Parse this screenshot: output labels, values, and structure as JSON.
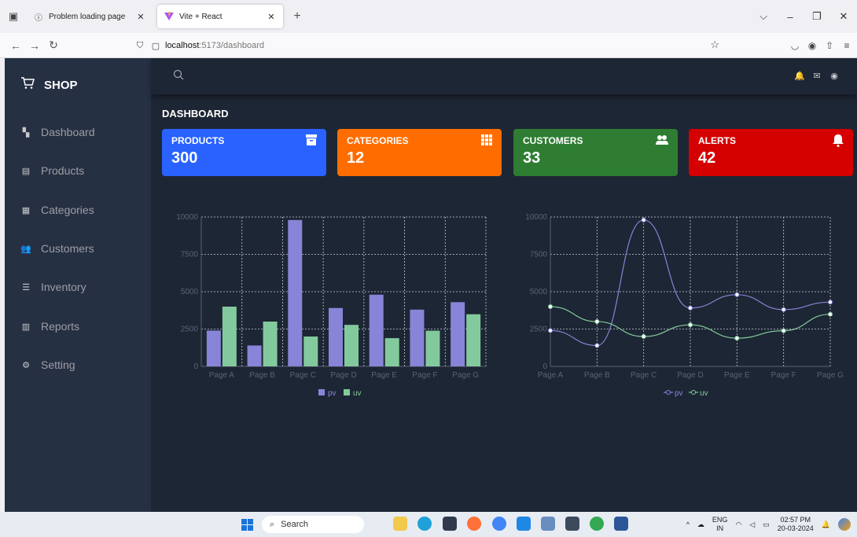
{
  "browser": {
    "tabs": [
      {
        "label": "Problem loading page",
        "icon": "info-icon"
      },
      {
        "label": "Vite + React",
        "icon": "vite-logo-icon",
        "active": true
      }
    ],
    "url_host": "localhost",
    "url_path": ":5173/dashboard"
  },
  "sidebar": {
    "brand": "SHOP",
    "items": [
      {
        "label": "Dashboard",
        "icon": "dashboard-icon"
      },
      {
        "label": "Products",
        "icon": "box-icon"
      },
      {
        "label": "Categories",
        "icon": "grid-icon"
      },
      {
        "label": "Customers",
        "icon": "people-icon"
      },
      {
        "label": "Inventory",
        "icon": "list-icon"
      },
      {
        "label": "Reports",
        "icon": "report-icon"
      },
      {
        "label": "Setting",
        "icon": "gear-icon"
      }
    ]
  },
  "main": {
    "title": "DASHBOARD",
    "cards": [
      {
        "title": "PRODUCTS",
        "value": "300",
        "color": "#2962ff",
        "icon": "archive-icon"
      },
      {
        "title": "CATEGORIES",
        "value": "12",
        "color": "#ff6d00",
        "icon": "grid-icon"
      },
      {
        "title": "CUSTOMERS",
        "value": "33",
        "color": "#2e7d32",
        "icon": "people-icon"
      },
      {
        "title": "ALERTS",
        "value": "42",
        "color": "#d50000",
        "icon": "bell-icon"
      }
    ]
  },
  "chart_data": [
    {
      "type": "bar",
      "categories": [
        "Page A",
        "Page B",
        "Page C",
        "Page D",
        "Page E",
        "Page F",
        "Page G"
      ],
      "series": [
        {
          "name": "pv",
          "values": [
            2400,
            1398,
            9800,
            3908,
            4800,
            3800,
            4300
          ],
          "color": "#8884d8"
        },
        {
          "name": "uv",
          "values": [
            4000,
            3000,
            2000,
            2780,
            1890,
            2390,
            3490
          ],
          "color": "#82ca9d"
        }
      ],
      "yticks": [
        "0",
        "2500",
        "5000",
        "7500",
        "10000"
      ],
      "ylim": [
        0,
        10000
      ],
      "grid": true,
      "legend": "bottom"
    },
    {
      "type": "line",
      "categories": [
        "Page A",
        "Page B",
        "Page C",
        "Page D",
        "Page E",
        "Page F",
        "Page G"
      ],
      "series": [
        {
          "name": "pv",
          "values": [
            2400,
            1398,
            9800,
            3908,
            4800,
            3800,
            4300
          ],
          "color": "#8884d8"
        },
        {
          "name": "uv",
          "values": [
            4000,
            3000,
            2000,
            2780,
            1890,
            2390,
            3490
          ],
          "color": "#82ca9d"
        }
      ],
      "yticks": [
        "0",
        "2500",
        "5000",
        "7500",
        "10000"
      ],
      "ylim": [
        0,
        10000
      ],
      "grid": true,
      "legend": "bottom"
    }
  ],
  "taskbar": {
    "search_label": "Search",
    "lang_line1": "ENG",
    "lang_line2": "IN",
    "time": "02:57 PM",
    "date": "20-03-2024"
  }
}
